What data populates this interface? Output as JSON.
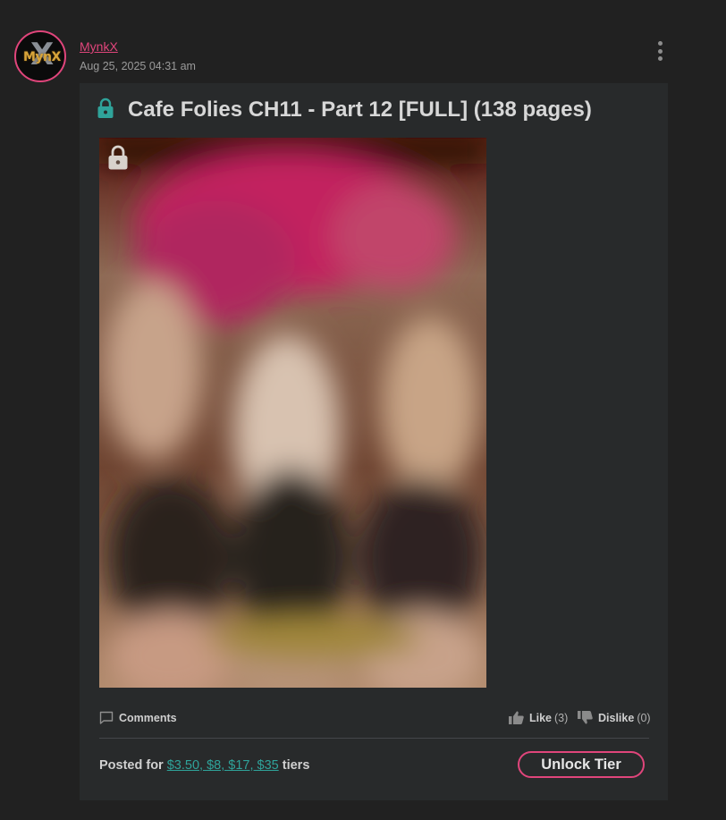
{
  "author": {
    "name": "MynkX",
    "avatar_text": "MynX",
    "date": "Aug 25, 2025 04:31 am"
  },
  "post": {
    "title": "Cafe Folies CH11 - Part 12 [FULL] (138 pages)",
    "image_locked": true
  },
  "actions": {
    "comments_label": "Comments",
    "like_label": "Like",
    "like_count": "(3)",
    "dislike_label": "Dislike",
    "dislike_count": "(0)"
  },
  "footer": {
    "posted_for_prefix": "Posted for",
    "tiers": "$3.50, $8, $17, $35",
    "tiers_suffix": "tiers",
    "unlock_label": "Unlock Tier"
  },
  "icons": {
    "title_lock": "lock-icon",
    "image_lock": "lock-icon",
    "comments": "comment-icon",
    "like": "thumbs-up-icon",
    "dislike": "thumbs-down-icon",
    "menu": "kebab-menu-icon"
  },
  "colors": {
    "background": "#212121",
    "card": "#282a2b",
    "accent_pink": "#e0457b",
    "accent_teal": "#2fa39a"
  }
}
